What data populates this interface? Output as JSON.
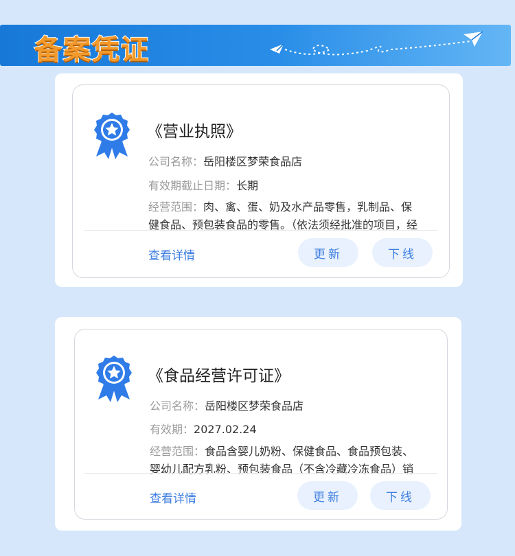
{
  "header": {
    "title": "备案凭证"
  },
  "cards": [
    {
      "title": "《营业执照》",
      "company_label": "公司名称：",
      "company_value": "岳阳楼区梦荣食品店",
      "validity_label": "有效期截止日期：",
      "validity_value": "长期",
      "scope_label": "经营范围：",
      "scope_value": "肉、禽、蛋、奶及水产品零售，乳制品、保健食品、预包装食品的零售。（依法须经批准的项目，经相关部门批准后方可开展经营活动）",
      "detail_link": "查看详情",
      "update_button": "更新",
      "offline_button": "下线"
    },
    {
      "title": "《食品经营许可证》",
      "company_label": "公司名称：",
      "company_value": "岳阳楼区梦荣食品店",
      "validity_label": "有效期：",
      "validity_value": "2027.02.24",
      "scope_label": "经营范围：",
      "scope_value": "食品含婴儿奶粉、保健食品、食品预包装、婴幼儿配方乳粉、预包装食品（不含冷藏冷冻食品）销售",
      "detail_link": "查看详情",
      "update_button": "更新",
      "offline_button": "下线"
    }
  ],
  "colors": {
    "accent": "#3d7ee0",
    "banner": "#1778d8",
    "title_orange": "#f39a2c",
    "background": "#d6e7fb"
  },
  "icons": {
    "badge": "award-ribbon-star-icon",
    "banner_decoration": "paper-plane-dotted-path-icon"
  }
}
